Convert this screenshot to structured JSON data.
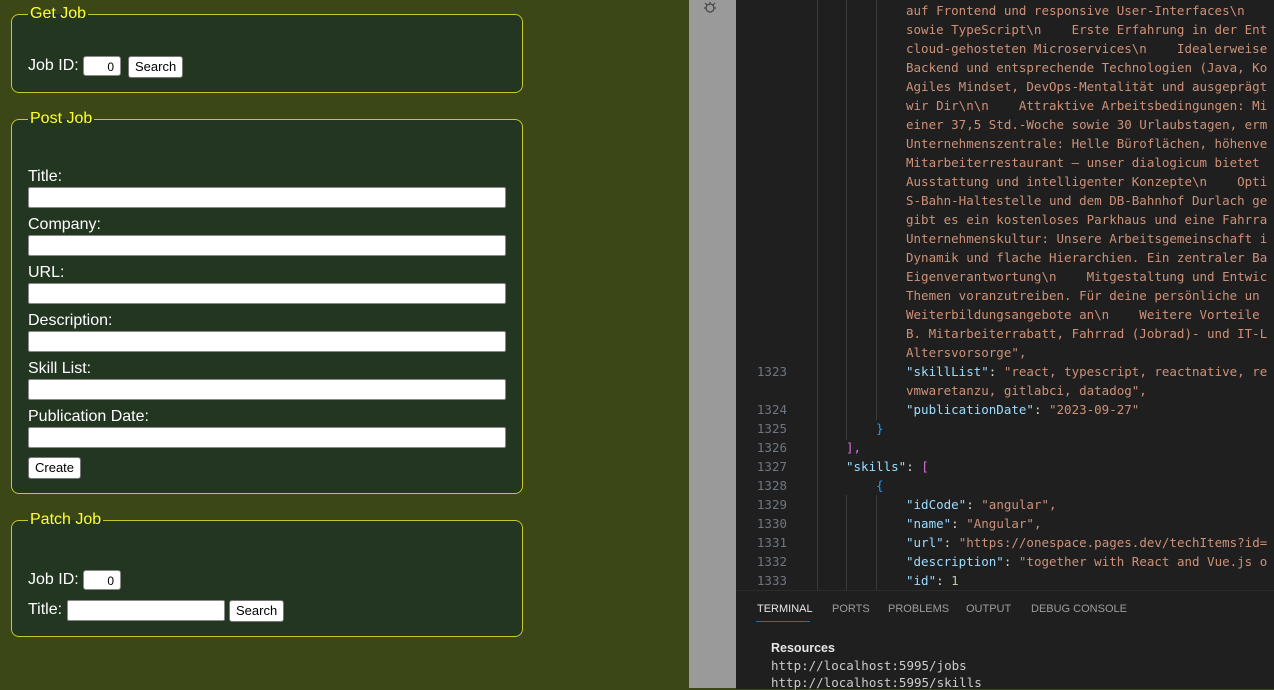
{
  "get_job": {
    "legend": "Get Job",
    "job_id_label": "Job ID:",
    "job_id_value": "0",
    "search_label": "Search"
  },
  "post_job": {
    "legend": "Post Job",
    "fields": [
      "Title:",
      "Company:",
      "URL:",
      "Description:",
      "Skill List:",
      "Publication Date:"
    ],
    "create_label": "Create"
  },
  "patch_job": {
    "legend": "Patch Job",
    "job_id_label": "Job ID:",
    "job_id_value": "0",
    "title_label": "Title:",
    "search_label": "Search"
  },
  "editor": {
    "wrapped_lines": [
      "auf Frontend und responsive User-Interfaces\\n",
      "sowie TypeScript\\n    Erste Erfahrung in der Ent",
      "cloud-gehosteten Microservices\\n    Idealerweise",
      "Backend und entsprechende Technologien (Java, Ko",
      "Agiles Mindset, DevOps-Mentalität und ausgeprägt",
      "wir Dir\\n\\n    Attraktive Arbeitsbedingungen: Mi",
      "einer 37,5 Std.-Woche sowie 30 Urlaubstagen, erm",
      "Unternehmenszentrale: Helle Büroflächen, höhenve",
      "Mitarbeiterrestaurant – unser dialogicum bietet",
      "Ausstattung und intelligenter Konzepte\\n    Opti",
      "S-Bahn-Haltestelle und dem DB-Bahnhof Durlach ge",
      "gibt es ein kostenloses Parkhaus und eine Fahrra",
      "Unternehmenskultur: Unsere Arbeitsgemeinschaft i",
      "Dynamik und flache Hierarchien. Ein zentraler Ba",
      "Eigenverantwortung\\n    Mitgestaltung und Entwic",
      "Themen voranzutreiben. Für deine persönliche un",
      "Weiterbildungsangebote an\\n    Weitere Vorteile",
      "B. Mitarbeiterrabatt, Fahrrad (Jobrad)- und IT-L",
      "Altersvorsorge\","
    ],
    "lines": [
      {
        "num": "1323",
        "key": "\"skillList\"",
        "sep": ": ",
        "value": "\"react, typescript, reactnative, re"
      },
      {
        "num": "",
        "value": "vmwaretanzu, gitlabci, datadog\","
      },
      {
        "num": "1324",
        "key": "\"publicationDate\"",
        "sep": ": ",
        "value": "\"2023-09-27\""
      },
      {
        "num": "1325",
        "punct": "}"
      },
      {
        "num": "1326",
        "punct": "],"
      },
      {
        "num": "1327",
        "key": "\"skills\"",
        "sep": ": ",
        "punct": "["
      },
      {
        "num": "1328",
        "punct": "{"
      },
      {
        "num": "1329",
        "key": "\"idCode\"",
        "sep": ": ",
        "value": "\"angular\","
      },
      {
        "num": "1330",
        "key": "\"name\"",
        "sep": ": ",
        "value": "\"Angular\","
      },
      {
        "num": "1331",
        "key": "\"url\"",
        "sep": ": ",
        "value": "\"https://onespace.pages.dev/techItems?id="
      },
      {
        "num": "1332",
        "key": "\"description\"",
        "sep": ": ",
        "value": "\"together with React and Vue.js o"
      },
      {
        "num": "1333",
        "key": "\"id\"",
        "sep": ": ",
        "number": "1"
      }
    ]
  },
  "panel": {
    "tabs": [
      "TERMINAL",
      "PORTS",
      "PROBLEMS",
      "OUTPUT",
      "DEBUG CONSOLE"
    ],
    "active_tab": "TERMINAL",
    "terminal_heading": "Resources",
    "terminal_lines": [
      "http://localhost:5995/jobs",
      "http://localhost:5995/skills"
    ]
  },
  "colors": {
    "app_bg": "#3b4716",
    "fieldset_bg": "#223622",
    "legend": "#ffff2e",
    "border": "#c8c82a"
  }
}
